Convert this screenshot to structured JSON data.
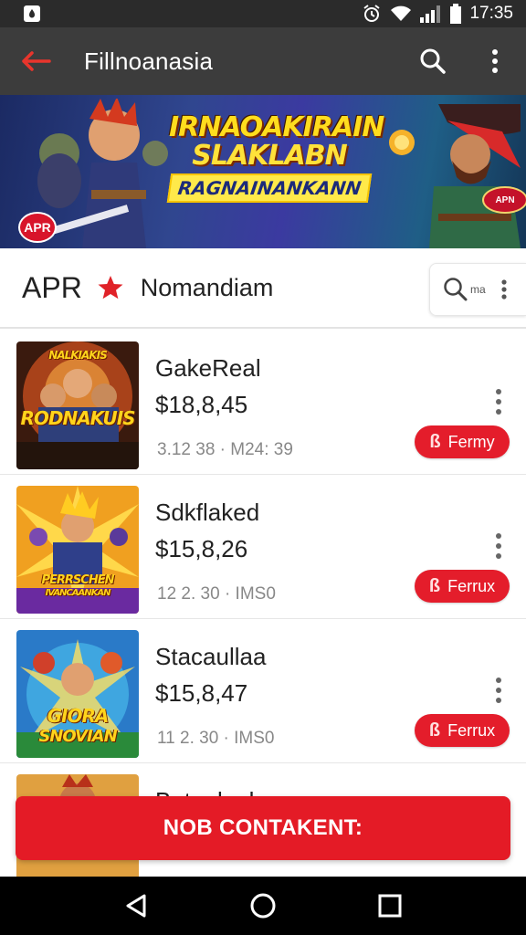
{
  "status_bar": {
    "time": "17:35"
  },
  "app_bar": {
    "title": "Fillnoanasia"
  },
  "banner": {
    "line1": "IRNAOAKIRAIN",
    "line2": "SLAKLABN",
    "line3": "RAGNAINANKANN",
    "badge_left": "APR",
    "badge_right": "APN"
  },
  "filter": {
    "apr_label": "APR",
    "category_label": "Nomandiam",
    "search_hint": "ma"
  },
  "items": [
    {
      "title": "GakeReal",
      "price": "$18,8,45",
      "meta": "3.12 38 · M24: 39",
      "action_label": "Fermy",
      "thumb_text": "RODNAKUIS",
      "thumb_top": "NALKIAKIS"
    },
    {
      "title": "Sdkflaked",
      "price": "$15,8,26",
      "meta": "12 2. 30 · IMS0",
      "action_label": "Ferrux",
      "thumb_text": "PERRSCHEN",
      "thumb_top": "IVANCAANKAN"
    },
    {
      "title": "Stacaullaa",
      "price": "$15,8,47",
      "meta": "11 2. 30 · IMS0",
      "action_label": "Ferrux",
      "thumb_text": "GIORA",
      "thumb_top": "SNOVIAN"
    },
    {
      "title": "Batanlool"
    }
  ],
  "cta": {
    "label": "NOB CONTAKENT:"
  },
  "colors": {
    "accent": "#e41b26",
    "app_bar": "#3c3c3c",
    "status_bar": "#2b2b2b"
  }
}
